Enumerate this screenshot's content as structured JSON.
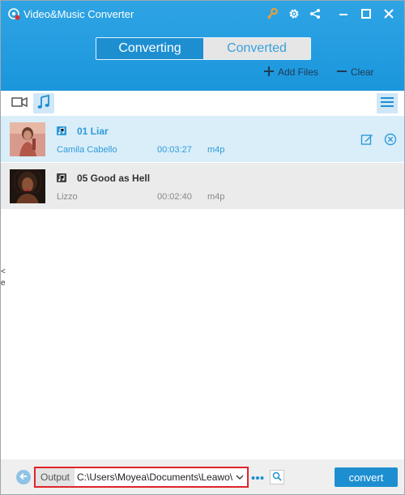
{
  "app": {
    "title": "Video&Music Converter"
  },
  "tabs": [
    {
      "label": "Converting",
      "active": true
    },
    {
      "label": "Converted",
      "active": false
    }
  ],
  "actions": {
    "add_files": "Add Files",
    "clear": "Clear"
  },
  "files": [
    {
      "title": "01 Liar",
      "artist": "Camila Cabello",
      "duration": "00:03:27",
      "format": "m4p",
      "selected": true
    },
    {
      "title": "05 Good as Hell",
      "artist": "Lizzo",
      "duration": "00:02:40",
      "format": "m4p",
      "selected": false
    }
  ],
  "side_marks": [
    "<",
    "e"
  ],
  "footer": {
    "output_label": "Output",
    "output_path": "C:\\Users\\Moyea\\Documents\\Leawo\\P",
    "convert_label": "convert"
  },
  "colors": {
    "header_blue": "#1b96dc",
    "accent": "#1d8fd1",
    "selected_row": "#d9eef9",
    "highlight_border": "#e0242b",
    "key_icon": "#f0a030"
  }
}
